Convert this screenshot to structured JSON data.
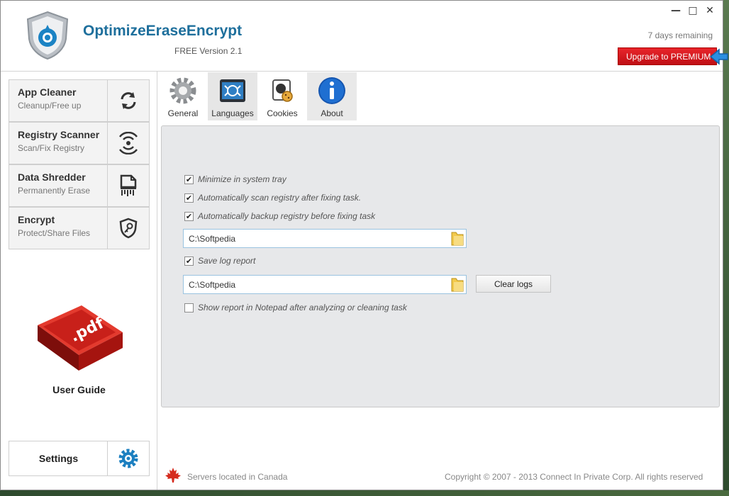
{
  "header": {
    "title": "OptimizeEraseEncrypt",
    "version": "FREE Version 2.1",
    "days_remaining": "7 days remaining",
    "upgrade_label": "Upgrade to PREMIUM",
    "window_controls": {
      "minimize": "—",
      "maximize": "□",
      "close": "✕"
    }
  },
  "sidebar": {
    "items": [
      {
        "title": "App Cleaner",
        "subtitle": "Cleanup/Free up",
        "icon": "refresh-icon"
      },
      {
        "title": "Registry Scanner",
        "subtitle": "Scan/Fix Registry",
        "icon": "scan-waves-icon"
      },
      {
        "title": "Data Shredder",
        "subtitle": "Permanently Erase",
        "icon": "shredder-icon"
      },
      {
        "title": "Encrypt",
        "subtitle": "Protect/Share Files",
        "icon": "shield-key-icon"
      }
    ],
    "user_guide": "User Guide",
    "settings": "Settings"
  },
  "tabs": [
    {
      "label": "General",
      "icon": "gear-icon"
    },
    {
      "label": "Languages",
      "icon": "languages-icon"
    },
    {
      "label": "Cookies",
      "icon": "cookie-icon"
    },
    {
      "label": "About",
      "icon": "info-icon"
    }
  ],
  "options": {
    "minimize_tray": {
      "label": "Minimize in system tray",
      "checked": true
    },
    "auto_scan": {
      "label": "Automatically scan registry after fixing task.",
      "checked": true
    },
    "auto_backup": {
      "label": "Automatically backup registry before fixing task",
      "checked": true
    },
    "backup_path": "C:\\Softpedia",
    "save_log": {
      "label": "Save log report",
      "checked": true
    },
    "log_path": "C:\\Softpedia",
    "clear_logs": "Clear logs",
    "show_notepad": {
      "label": "Show report in Notepad after analyzing or cleaning task",
      "checked": false
    }
  },
  "footer": {
    "servers": "Servers located in Canada",
    "copyright": "Copyright © 2007 - 2013  Connect In Private Corp. All rights reserved"
  },
  "colors": {
    "brand": "#1e6f9c",
    "upgrade": "#d9171d"
  }
}
